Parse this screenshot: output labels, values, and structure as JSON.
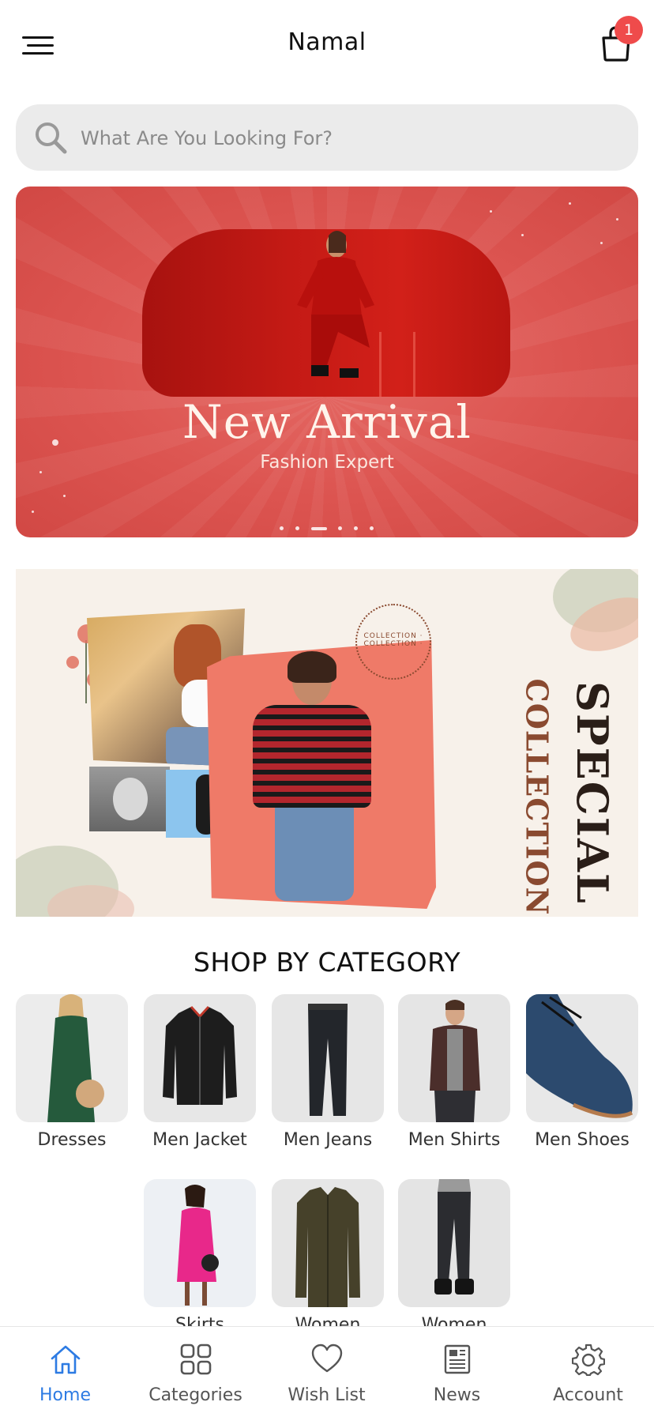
{
  "header": {
    "title": "Namal",
    "cart_count": "1"
  },
  "search": {
    "placeholder": "What Are You Looking For?"
  },
  "hero_banner": {
    "title": "New Arrival",
    "subtitle": "Fashion Expert",
    "slides_count": 6,
    "active_slide": 3,
    "colors": {
      "background": "#dc5450",
      "arch": "#c41a15"
    }
  },
  "promo_banner": {
    "vertical_text_1": "SPECIAL",
    "vertical_text_2": "COLLECTION",
    "ring_text": "COLLECTION · COLLECTION ·"
  },
  "categories": {
    "title": "SHOP BY CATEGORY",
    "items": [
      {
        "label": "Dresses"
      },
      {
        "label": "Men Jacket"
      },
      {
        "label": "Men Jeans"
      },
      {
        "label": "Men Shirts"
      },
      {
        "label": "Men Shoes"
      },
      {
        "label": "Skirts"
      },
      {
        "label": "Women"
      },
      {
        "label": "Women"
      }
    ]
  },
  "bottom_nav": {
    "active": "Home",
    "accent_color": "#2d7be3",
    "items": [
      {
        "label": "Home",
        "icon": "home-icon"
      },
      {
        "label": "Categories",
        "icon": "grid-icon"
      },
      {
        "label": "Wish List",
        "icon": "heart-icon"
      },
      {
        "label": "News",
        "icon": "newspaper-icon"
      },
      {
        "label": "Account",
        "icon": "gear-icon"
      }
    ]
  }
}
